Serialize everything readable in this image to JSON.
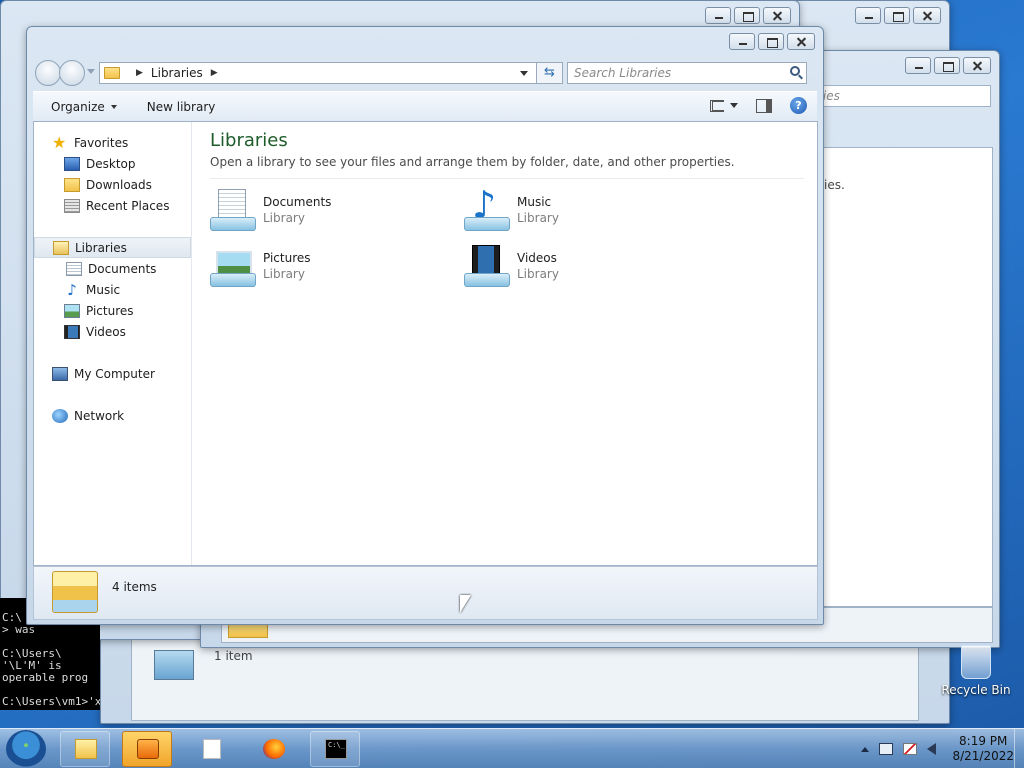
{
  "desktop": {
    "recycle_bin": "Recycle Bin"
  },
  "cmd": {
    "lines": [
      "C:\\",
      "> was",
      "",
      "C:\\Users\\",
      "'\\L'M' is",
      "operable prog",
      "",
      "C:\\Users\\vm1>'x"
    ]
  },
  "bg_windows": {
    "search_frag": "ries",
    "sub_frag": "ies.",
    "status_count": "1 item"
  },
  "window": {
    "address": {
      "crumb": "Libraries"
    },
    "search": {
      "placeholder": "Search Libraries"
    },
    "toolbar": {
      "organize": "Organize",
      "new_library": "New library"
    },
    "nav": {
      "favorites": "Favorites",
      "desktop": "Desktop",
      "downloads": "Downloads",
      "recent_places": "Recent Places",
      "libraries": "Libraries",
      "documents": "Documents",
      "music": "Music",
      "pictures": "Pictures",
      "videos": "Videos",
      "my_computer": "My Computer",
      "network": "Network"
    },
    "main": {
      "title": "Libraries",
      "subtitle": "Open a library to see your files and arrange them by folder, date, and other properties.",
      "items": [
        {
          "name": "Documents",
          "type": "Library"
        },
        {
          "name": "Music",
          "type": "Library"
        },
        {
          "name": "Pictures",
          "type": "Library"
        },
        {
          "name": "Videos",
          "type": "Library"
        }
      ]
    },
    "details": {
      "count": "4 items"
    }
  },
  "taskbar": {
    "clock_time": "8:19 PM",
    "clock_date": "8/21/2022"
  },
  "colors": {
    "accent": "#1e5c2a",
    "desktop": "#2a7ad2"
  }
}
